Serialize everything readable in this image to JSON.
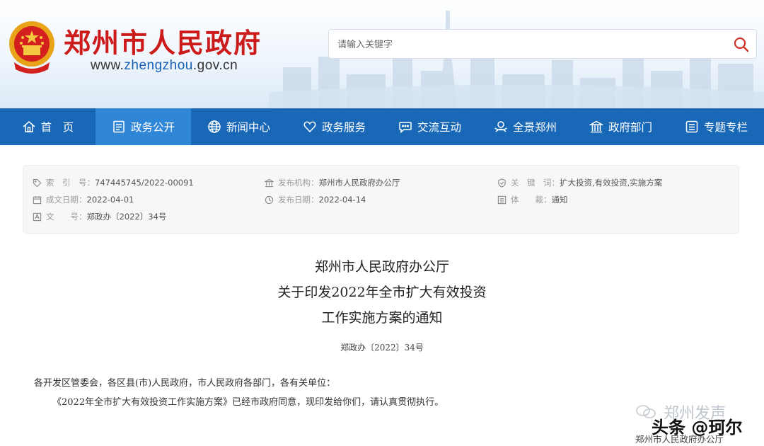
{
  "header": {
    "site_title": "郑州市人民政府",
    "url_prefix": "www.",
    "url_highlight": "zhengzhou",
    "url_suffix": ".gov.cn",
    "search_placeholder": "请输入关键字",
    "search_icon": "search-icon"
  },
  "nav": {
    "items": [
      {
        "label": "首　页",
        "icon": "home-icon"
      },
      {
        "label": "政务公开",
        "icon": "document-icon"
      },
      {
        "label": "新闻中心",
        "icon": "globe-icon"
      },
      {
        "label": "政务服务",
        "icon": "heart-icon"
      },
      {
        "label": "交流互动",
        "icon": "chat-icon"
      },
      {
        "label": "全景郑州",
        "icon": "user-view-icon"
      },
      {
        "label": "政府部门",
        "icon": "building-icon"
      },
      {
        "label": "专题专栏",
        "icon": "list-icon"
      }
    ],
    "active_index": 1,
    "bar_color": "#1868b7",
    "active_color": "#2f86d6"
  },
  "meta": {
    "index_label": "索　引　号：",
    "index_value": "747445745/2022-00091",
    "created_label": "成文日期：",
    "created_value": "2022-04-01",
    "docno_label": "文　　号：",
    "docno_value": "郑政办〔2022〕34号",
    "issuer_label": "发布机构：",
    "issuer_value": "郑州市人民政府办公厅",
    "published_label": "发布日期：",
    "published_value": "2022-04-14",
    "keywords_label": "关　键　词：",
    "keywords_value": "扩大投资,有效投资,实施方案",
    "genre_label": "体　　裁：",
    "genre_value": "通知"
  },
  "document": {
    "title_line1": "郑州市人民政府办公厅",
    "title_line2": "关于印发2022年全市扩大有效投资",
    "title_line3": "工作实施方案的通知",
    "number": "郑政办〔2022〕34号",
    "para1": "各开发区管委会，各区县(市)人民政府，市人民政府各部门，各有关单位：",
    "para2": "《2022年全市扩大有效投资工作实施方案》已经市政府同意，现印发给你们，请认真贯彻执行。"
  },
  "watermark": {
    "line1": "郑州发声",
    "line2": "头条 @珂尔",
    "line3": "郑州市人民政府办公厅"
  },
  "colors": {
    "title_red": "#cc1b1b",
    "url_blue": "#1a5fb4",
    "search_red": "#d0342c"
  }
}
